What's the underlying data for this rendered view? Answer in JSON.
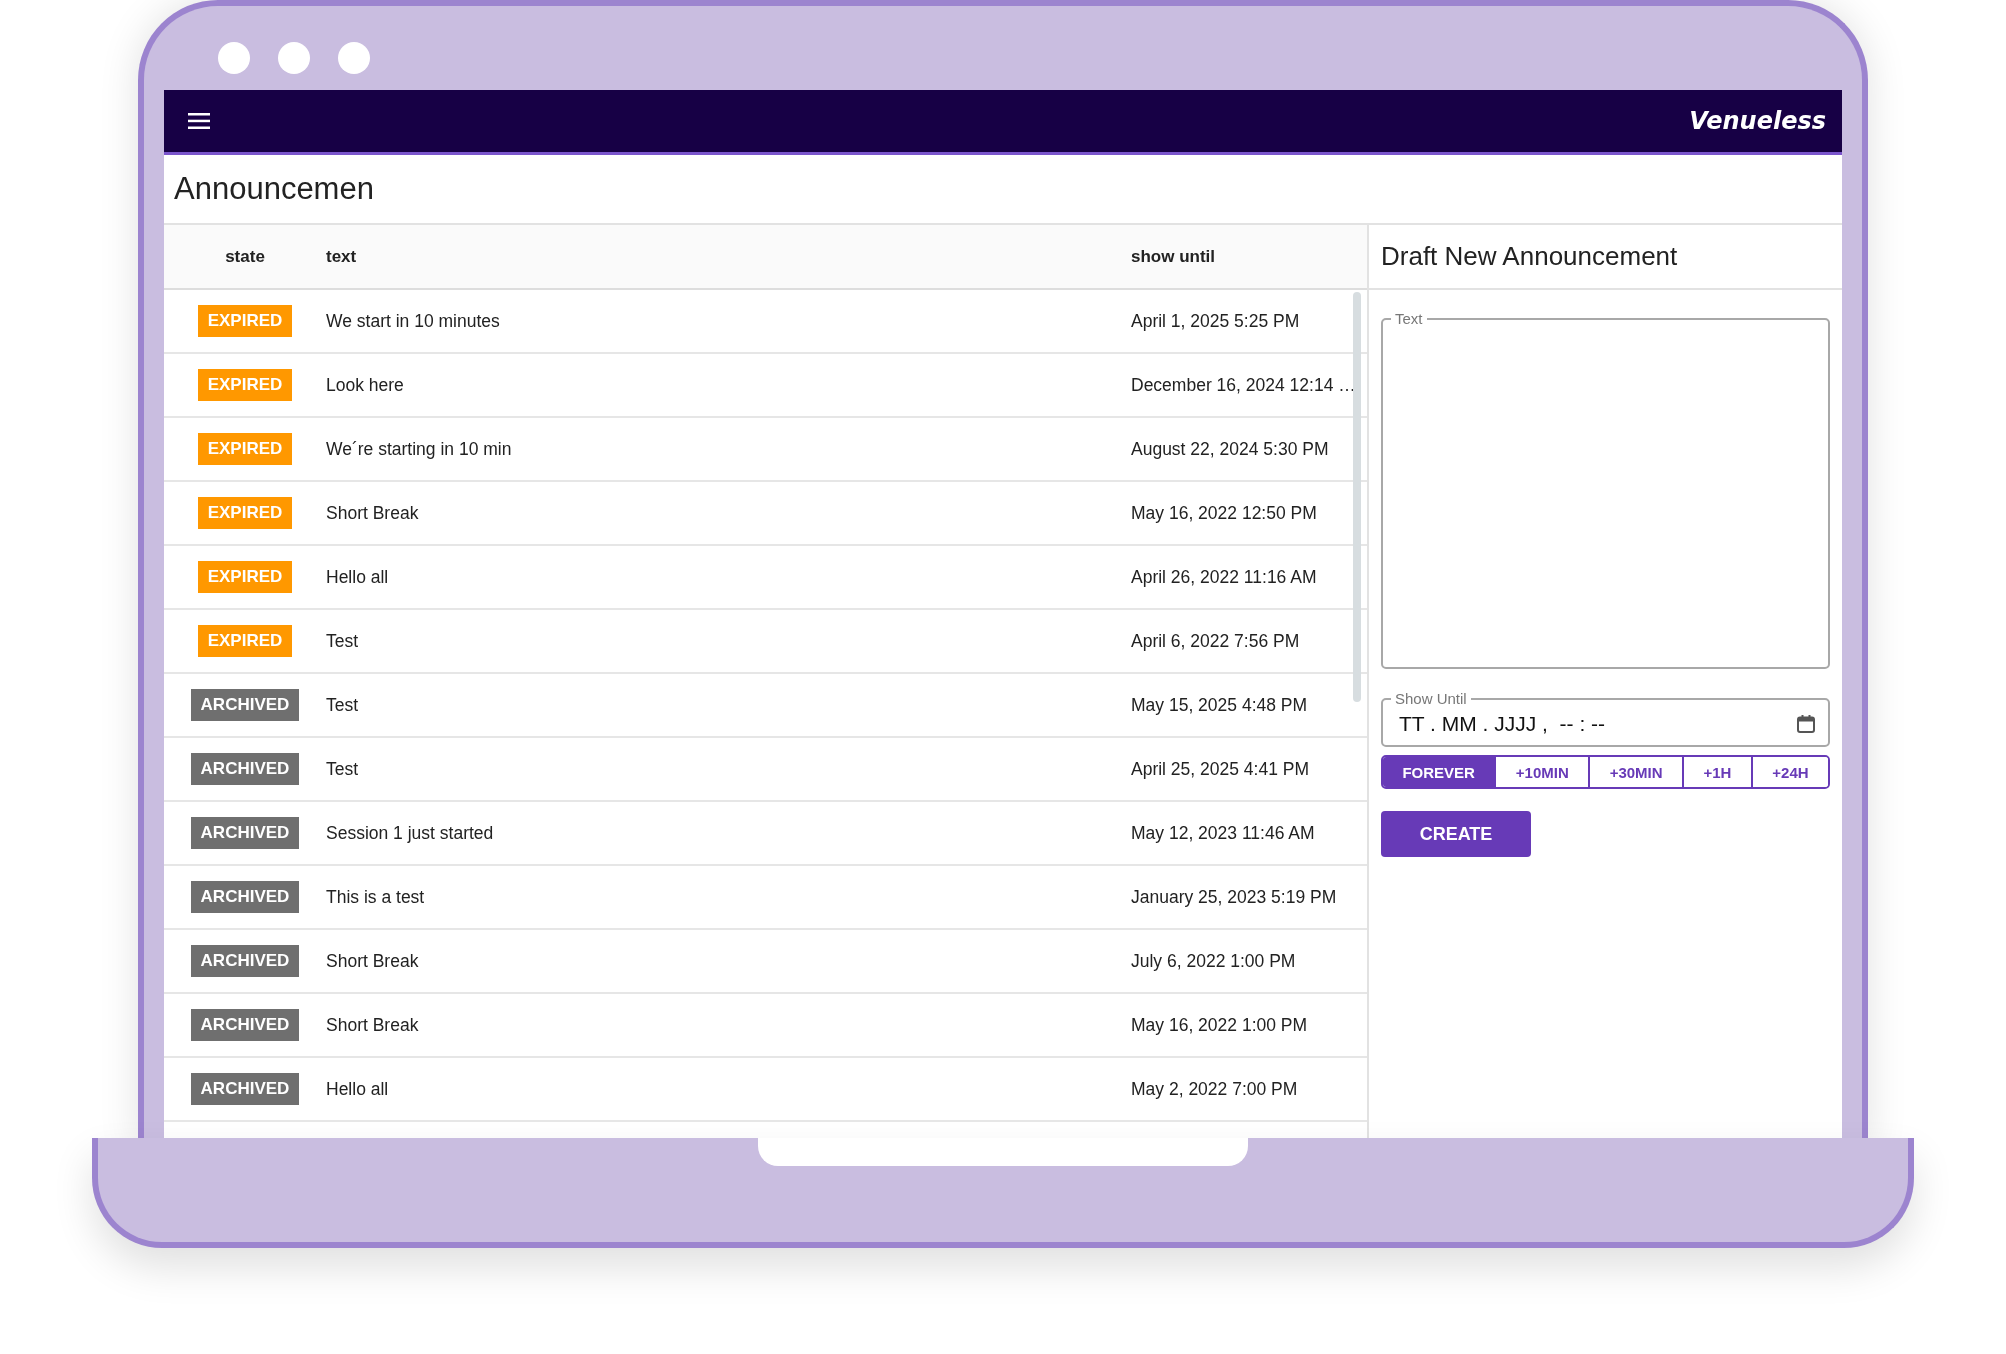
{
  "navbar": {
    "logo": "Venueless"
  },
  "page": {
    "title": "Announcemen"
  },
  "table": {
    "columns": [
      "state",
      "text",
      "show until"
    ],
    "rows": [
      {
        "state": {
          "kind": "expired",
          "label": "EXPIRED"
        },
        "text": "We start in 10 minutes",
        "show_until": "April 1, 2025 5:25 PM"
      },
      {
        "state": {
          "kind": "expired",
          "label": "EXPIRED"
        },
        "text": "Look here",
        "show_until": "December 16, 2024 12:14 …"
      },
      {
        "state": {
          "kind": "expired",
          "label": "EXPIRED"
        },
        "text": "We´re starting in 10 min",
        "show_until": "August 22, 2024 5:30 PM"
      },
      {
        "state": {
          "kind": "expired",
          "label": "EXPIRED"
        },
        "text": "Short Break",
        "show_until": "May 16, 2022 12:50 PM"
      },
      {
        "state": {
          "kind": "expired",
          "label": "EXPIRED"
        },
        "text": "Hello all",
        "show_until": "April 26, 2022 11:16 AM"
      },
      {
        "state": {
          "kind": "expired",
          "label": "EXPIRED"
        },
        "text": "Test",
        "show_until": "April 6, 2022 7:56 PM"
      },
      {
        "state": {
          "kind": "archived",
          "label": "ARCHIVED"
        },
        "text": "Test",
        "show_until": "May 15, 2025 4:48 PM"
      },
      {
        "state": {
          "kind": "archived",
          "label": "ARCHIVED"
        },
        "text": "Test",
        "show_until": "April 25, 2025 4:41 PM"
      },
      {
        "state": {
          "kind": "archived",
          "label": "ARCHIVED"
        },
        "text": "Session 1 just started",
        "show_until": "May 12, 2023 11:46 AM"
      },
      {
        "state": {
          "kind": "archived",
          "label": "ARCHIVED"
        },
        "text": "This is a test",
        "show_until": "January 25, 2023 5:19 PM"
      },
      {
        "state": {
          "kind": "archived",
          "label": "ARCHIVED"
        },
        "text": "Short Break",
        "show_until": "July 6, 2022 1:00 PM"
      },
      {
        "state": {
          "kind": "archived",
          "label": "ARCHIVED"
        },
        "text": "Short Break",
        "show_until": "May 16, 2022 1:00 PM"
      },
      {
        "state": {
          "kind": "archived",
          "label": "ARCHIVED"
        },
        "text": "Hello all",
        "show_until": "May 2, 2022 7:00 PM"
      }
    ]
  },
  "draft": {
    "title": "Draft New Announcement",
    "text_field": {
      "label": "Text"
    },
    "show_until_field": {
      "label": "Show Until",
      "placeholder": "TT . MM . JJJJ ,  -- : --"
    },
    "presets": [
      {
        "label": "FOREVER",
        "selected": true
      },
      {
        "label": "+10MIN",
        "selected": false
      },
      {
        "label": "+30MIN",
        "selected": false
      },
      {
        "label": "+1H",
        "selected": false
      },
      {
        "label": "+24H",
        "selected": false
      }
    ],
    "create_button": "CREATE"
  }
}
